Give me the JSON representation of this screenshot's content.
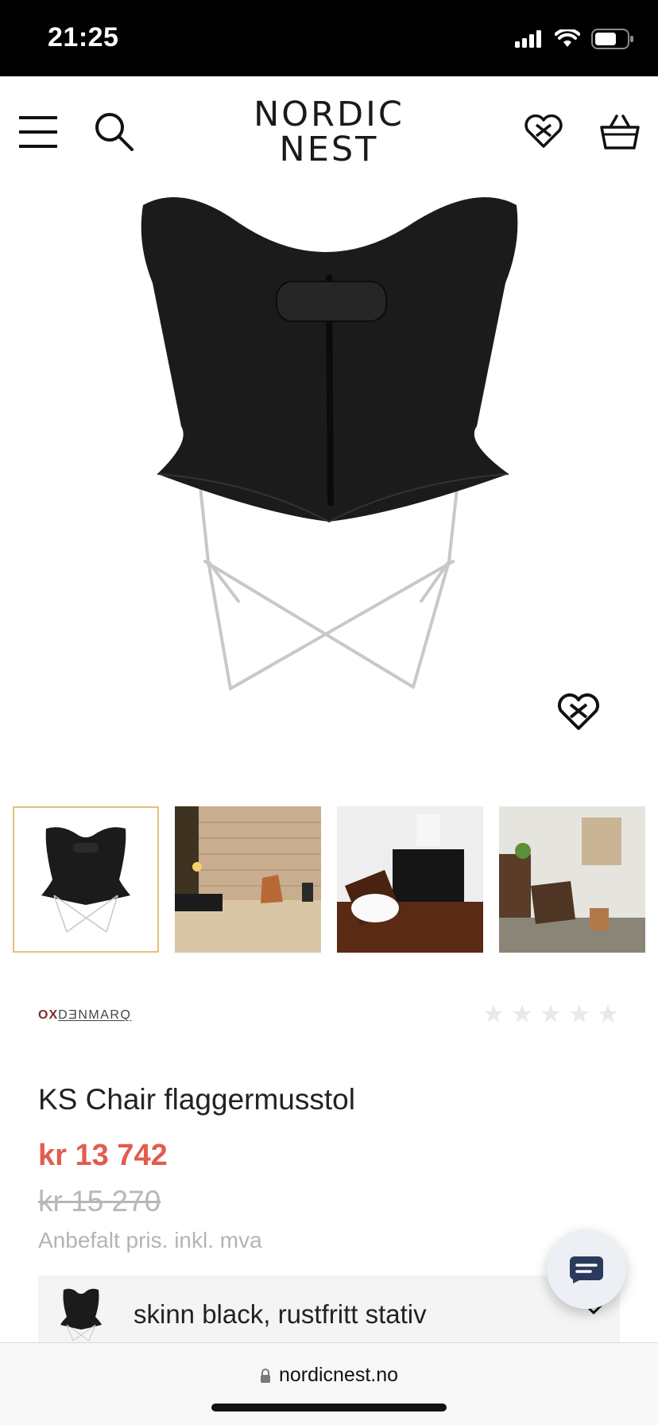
{
  "status_bar": {
    "time": "21:25"
  },
  "header": {
    "logo_line1": "NORDIC",
    "logo_line2": "NEST",
    "icons": [
      "menu-icon",
      "search-icon",
      "wishlist-heart-icon",
      "basket-icon"
    ]
  },
  "product": {
    "brand": {
      "prefix": "OX",
      "rest": "DƎNMARQ"
    },
    "rating_stars": 5,
    "rating_value": 0,
    "title": "KS Chair flaggermusstol",
    "price_sale": "kr 13 742",
    "price_original": "kr 15 270",
    "price_note": "Anbefalt pris. inkl. mva",
    "variant_label": "skinn black, rustfritt stativ"
  },
  "gallery": {
    "thumbnail_count": 4,
    "active_index": 0
  },
  "browser": {
    "url": "nordicnest.no"
  },
  "colors": {
    "sale_price": "#e25c4f",
    "original_price": "#b7b7b7",
    "active_thumb_border": "#e3c07c",
    "chat_icon": "#2b3a5c"
  }
}
